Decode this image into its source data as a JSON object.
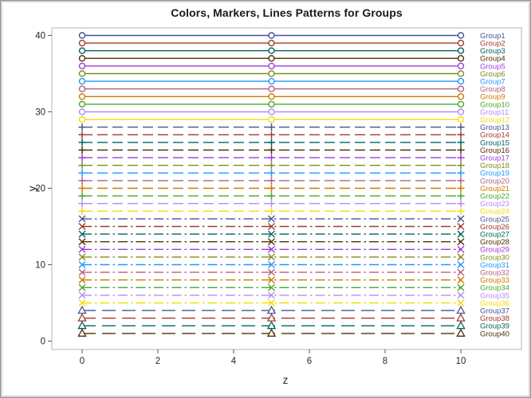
{
  "chart_data": {
    "type": "line",
    "title": "Colors, Markers, Lines Patterns for Groups",
    "xlabel": "z",
    "ylabel": "y",
    "xlim": [
      0,
      10
    ],
    "ylim": [
      0,
      40
    ],
    "xticks": [
      0,
      2,
      4,
      6,
      8,
      10
    ],
    "yticks": [
      0,
      10,
      20,
      30,
      40
    ],
    "grid": false,
    "legend_position": "curve-labels-right-inside-plot",
    "markers_at_x": [
      0,
      5,
      10
    ],
    "palette": [
      "#445694",
      "#A23A2E",
      "#01665E",
      "#543005",
      "#9D3CDB",
      "#7F8E1F",
      "#2597FA",
      "#B26084",
      "#D17800",
      "#47A82A",
      "#B38EF3",
      "#F9DA04"
    ],
    "style_cycles": [
      {
        "marker": "circle",
        "pattern": "solid",
        "dash": ""
      },
      {
        "marker": "plus",
        "pattern": "medium-dash",
        "dash": "13,6"
      },
      {
        "marker": "x",
        "pattern": "dash-dot",
        "dash": "12,4,2.5,4"
      },
      {
        "marker": "triangle",
        "pattern": "long-dash",
        "dash": "17,8"
      }
    ],
    "series": [
      {
        "name": "Group1",
        "y": 40
      },
      {
        "name": "Group2",
        "y": 39
      },
      {
        "name": "Group3",
        "y": 38
      },
      {
        "name": "Group4",
        "y": 37
      },
      {
        "name": "Group5",
        "y": 36
      },
      {
        "name": "Group6",
        "y": 35
      },
      {
        "name": "Group7",
        "y": 34
      },
      {
        "name": "Group8",
        "y": 33
      },
      {
        "name": "Group9",
        "y": 32
      },
      {
        "name": "Group10",
        "y": 31
      },
      {
        "name": "Group11",
        "y": 30
      },
      {
        "name": "Group12",
        "y": 29
      },
      {
        "name": "Group13",
        "y": 28
      },
      {
        "name": "Group14",
        "y": 27
      },
      {
        "name": "Group15",
        "y": 26
      },
      {
        "name": "Group16",
        "y": 25
      },
      {
        "name": "Group17",
        "y": 24
      },
      {
        "name": "Group18",
        "y": 23
      },
      {
        "name": "Group19",
        "y": 22
      },
      {
        "name": "Group20",
        "y": 21
      },
      {
        "name": "Group21",
        "y": 20
      },
      {
        "name": "Group22",
        "y": 19
      },
      {
        "name": "Group23",
        "y": 18
      },
      {
        "name": "Group24",
        "y": 17
      },
      {
        "name": "Group25",
        "y": 16
      },
      {
        "name": "Group26",
        "y": 15
      },
      {
        "name": "Group27",
        "y": 14
      },
      {
        "name": "Group28",
        "y": 13
      },
      {
        "name": "Group29",
        "y": 12
      },
      {
        "name": "Group30",
        "y": 11
      },
      {
        "name": "Group31",
        "y": 10
      },
      {
        "name": "Group32",
        "y": 9
      },
      {
        "name": "Group33",
        "y": 8
      },
      {
        "name": "Group34",
        "y": 7
      },
      {
        "name": "Group35",
        "y": 6
      },
      {
        "name": "Group36",
        "y": 5
      },
      {
        "name": "Group37",
        "y": 4
      },
      {
        "name": "Group38",
        "y": 3
      },
      {
        "name": "Group39",
        "y": 2
      },
      {
        "name": "Group40",
        "y": 1
      }
    ],
    "wall_border_color": "#b5b5b5",
    "tick_color": "#5a5a5a"
  }
}
